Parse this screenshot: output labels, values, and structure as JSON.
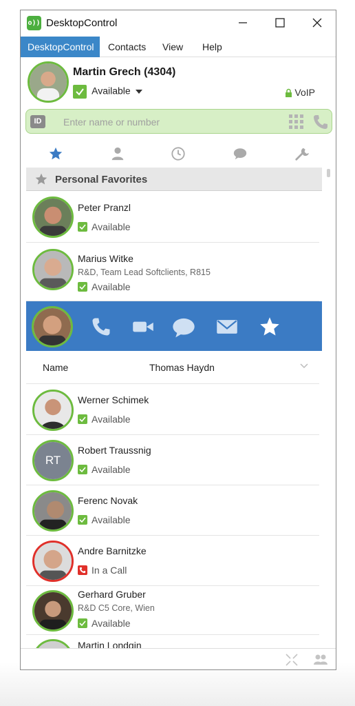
{
  "window": {
    "title": "DesktopControl",
    "logo_text": "o))"
  },
  "menu": [
    {
      "label": "DesktopControl"
    },
    {
      "label": "Contacts"
    },
    {
      "label": "View"
    },
    {
      "label": "Help"
    }
  ],
  "profile": {
    "name": "Martin Grech (4304)",
    "status": "Available",
    "line_type": "VoIP"
  },
  "search": {
    "badge": "ID",
    "placeholder": "Enter name or number"
  },
  "tabs": [
    "favorites-tab",
    "contacts-tab",
    "history-tab",
    "chat-tab",
    "settings-tab"
  ],
  "favorites": {
    "section_title": "Personal Favorites",
    "contacts": [
      {
        "name": "Peter Pranzl",
        "subtitle": "",
        "status": "Available",
        "state": "available"
      },
      {
        "name": "Marius Witke",
        "subtitle": "R&D, Team Lead Softclients, R815",
        "status": "Available",
        "state": "available"
      }
    ],
    "selected": {
      "actions": [
        "phone-icon",
        "video-icon",
        "chat-icon",
        "mail-icon",
        "star-icon"
      ],
      "detail_label": "Name",
      "detail_value": "Thomas Haydn"
    },
    "more_contacts": [
      {
        "name": "Werner Schimek",
        "subtitle": "",
        "status": "Available",
        "state": "available"
      },
      {
        "name": "Robert Traussnig",
        "subtitle": "",
        "status": "Available",
        "state": "available",
        "initials": "RT"
      },
      {
        "name": "Ferenc Novak",
        "subtitle": "",
        "status": "Available",
        "state": "available"
      },
      {
        "name": "Andre Barnitzke",
        "subtitle": "",
        "status": "In a Call",
        "state": "busy"
      },
      {
        "name": "Gerhard Gruber",
        "subtitle": "R&D C5 Core, Wien",
        "status": "Available",
        "state": "available"
      },
      {
        "name": "Martin Londgin",
        "subtitle": "",
        "status": "",
        "state": "available"
      }
    ]
  },
  "colors": {
    "accent": "#3b7bc4",
    "available": "#6dbb3f",
    "busy": "#e0302a",
    "search_bg": "#d7efc6"
  }
}
